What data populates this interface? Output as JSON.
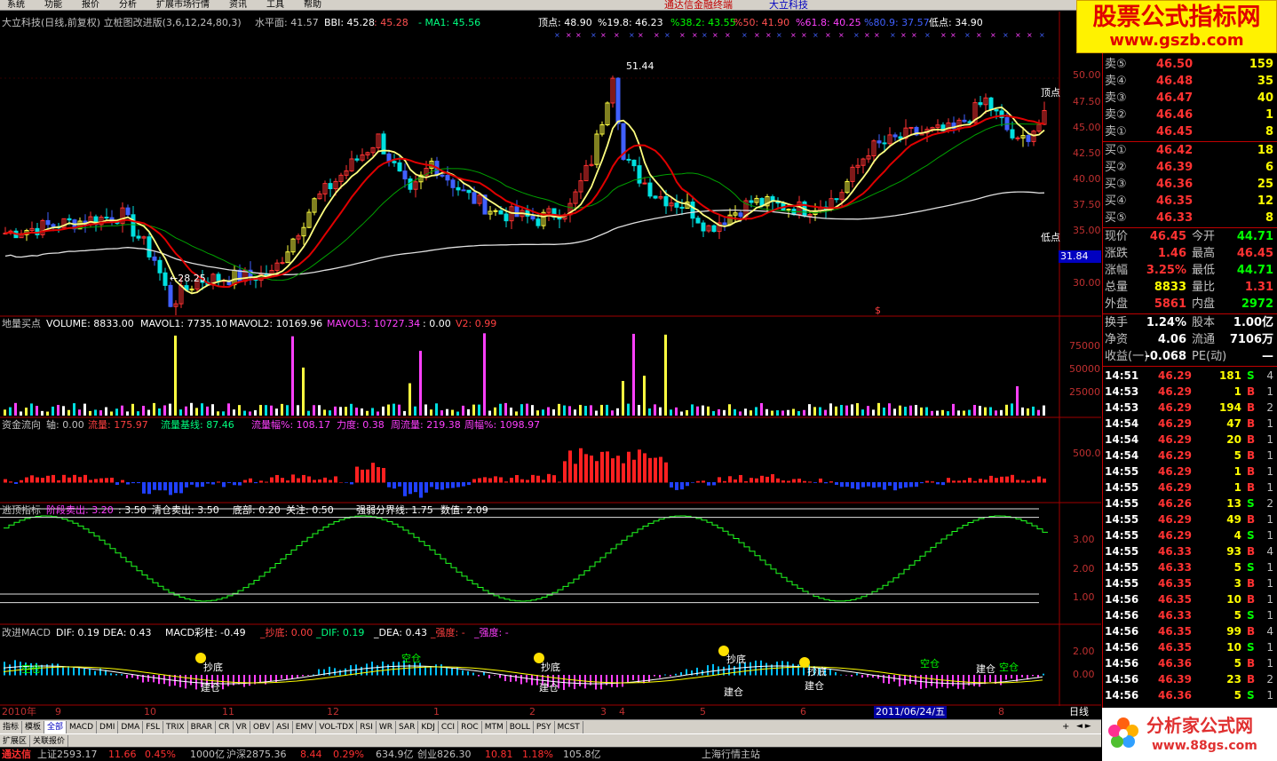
{
  "menu": {
    "items": [
      "系统",
      "功能",
      "报价",
      "分析",
      "扩展市场行情",
      "资讯",
      "工具",
      "帮助"
    ],
    "app_title": "通达信金融终端",
    "stock_title": "大立科技"
  },
  "brand": {
    "title": "股票公式指标网",
    "url": "www.gszb.com"
  },
  "main": {
    "title": "大立科技(日线,前复权) 立桩图改进版(3,6,12,24,80,3)",
    "level": "水平面: 41.57",
    "bbi": "BBI: 45.28",
    "v1": ": 45.28",
    "ma1": "- MA1: 45.56",
    "ding": "顶点: 48.90",
    "p198": "%19.8: 46.23",
    "p382": "%38.2: 43.55",
    "p50": "%50: 41.90",
    "p618": "%61.8: 40.25",
    "p809": "%80.9: 37.57",
    "di": "低点: 34.90",
    "high_label": "51.44",
    "low_label": "←28.25",
    "top_marker": "顶点",
    "bottom_marker": "低点",
    "price_flag": "31.84",
    "s_mark": "$",
    "yticks": [
      "50.00",
      "47.50",
      "45.00",
      "42.50",
      "40.00",
      "37.50",
      "35.00",
      "30.00"
    ]
  },
  "volume": {
    "title": "地量买点",
    "vol": "VOLUME: 8833.00",
    "mavol1": "MAVOL1: 7735.10",
    "mavol2": "MAVOL2: 10169.96",
    "mavol3": "MAVOL3: 10727.34",
    "v1": ": 0.00",
    "v2": "V2: 0.99",
    "yticks": [
      "75000",
      "50000",
      "25000"
    ]
  },
  "fund": {
    "title": "资金流向",
    "axis": "轴: 0.00",
    "flow": "流量: 175.97",
    "base": "流量基线: 87.46",
    "amp": "流量幅%: 108.17",
    "force": "力度: 0.38",
    "week": "周流量: 219.38",
    "weekamp": "周幅%: 1098.97",
    "yticks": [
      "500.0"
    ]
  },
  "escape": {
    "title": "逃顶指标",
    "stage": "阶段卖出: 3.20",
    "v": ": 3.50",
    "clear": "清仓卖出: 3.50",
    "bottom": "底部: 0.20",
    "focus": "关注: 0.50",
    "line": "强弱分界线: 1.75",
    "value": "数值: 2.09",
    "yticks": [
      "3.00",
      "2.00",
      "1.00"
    ]
  },
  "macd": {
    "title": "改进MACD",
    "dif": "DIF: 0.19",
    "dea": "DEA: 0.43",
    "bar": "MACD彩柱: -0.49",
    "chaodi": "_抄底: 0.00",
    "dif2": "_DIF: 0.19",
    "dea2": "_DEA: 0.43",
    "strong": "_强度: -",
    "strong2": "_强度: -",
    "yticks": [
      "2.00",
      "0.00"
    ],
    "marks": [
      "抄底",
      "抄底",
      "抄底",
      "抄底",
      "建仓",
      "建仓",
      "建仓",
      "建仓",
      "建仓",
      "空仓",
      "空仓",
      "空仓",
      "空仓"
    ]
  },
  "xaxis": {
    "labels": [
      "2010年",
      "9",
      "10",
      "11",
      "12",
      "1",
      "2",
      "3",
      "4",
      "5",
      "6",
      "2011/06/24/五",
      "8"
    ],
    "period": "日线"
  },
  "quote": {
    "asks": [
      {
        "label": "卖⑤",
        "price": "46.50",
        "vol": "159"
      },
      {
        "label": "卖④",
        "price": "46.48",
        "vol": "35"
      },
      {
        "label": "卖③",
        "price": "46.47",
        "vol": "40"
      },
      {
        "label": "卖②",
        "price": "46.46",
        "vol": "1"
      },
      {
        "label": "卖①",
        "price": "46.45",
        "vol": "8"
      }
    ],
    "bids": [
      {
        "label": "买①",
        "price": "46.42",
        "vol": "18"
      },
      {
        "label": "买②",
        "price": "46.39",
        "vol": "6"
      },
      {
        "label": "买③",
        "price": "46.36",
        "vol": "25"
      },
      {
        "label": "买④",
        "price": "46.35",
        "vol": "12"
      },
      {
        "label": "买⑤",
        "price": "46.33",
        "vol": "8"
      }
    ],
    "stats": [
      {
        "l1": "现价",
        "v1": "46.45",
        "c1": "#ff3232",
        "l2": "今开",
        "v2": "44.71",
        "c2": "#00ff00"
      },
      {
        "l1": "涨跌",
        "v1": "1.46",
        "c1": "#ff3232",
        "l2": "最高",
        "v2": "46.45",
        "c2": "#ff3232"
      },
      {
        "l1": "涨幅",
        "v1": "3.25%",
        "c1": "#ff3232",
        "l2": "最低",
        "v2": "44.71",
        "c2": "#00ff00"
      },
      {
        "l1": "总量",
        "v1": "8833",
        "c1": "#ffff00",
        "l2": "量比",
        "v2": "1.31",
        "c2": "#ff3232"
      },
      {
        "l1": "外盘",
        "v1": "5861",
        "c1": "#ff3232",
        "l2": "内盘",
        "v2": "2972",
        "c2": "#00ff00"
      }
    ],
    "stats2": [
      {
        "l1": "换手",
        "v1": "1.24%",
        "l2": "股本",
        "v2": "1.00亿"
      },
      {
        "l1": "净资",
        "v1": "4.06",
        "l2": "流通",
        "v2": "7106万"
      },
      {
        "l1": "收益(一)",
        "v1": "-0.068",
        "l2": "PE(动)",
        "v2": "—"
      }
    ]
  },
  "ticks": [
    {
      "t": "14:51",
      "p": "46.29",
      "v": "181",
      "d": "S",
      "n": "4"
    },
    {
      "t": "14:53",
      "p": "46.29",
      "v": "1",
      "d": "B",
      "n": "1"
    },
    {
      "t": "14:53",
      "p": "46.29",
      "v": "194",
      "d": "B",
      "n": "2"
    },
    {
      "t": "14:54",
      "p": "46.29",
      "v": "47",
      "d": "B",
      "n": "1"
    },
    {
      "t": "14:54",
      "p": "46.29",
      "v": "20",
      "d": "B",
      "n": "1"
    },
    {
      "t": "14:54",
      "p": "46.29",
      "v": "5",
      "d": "B",
      "n": "1"
    },
    {
      "t": "14:55",
      "p": "46.29",
      "v": "1",
      "d": "B",
      "n": "1"
    },
    {
      "t": "14:55",
      "p": "46.29",
      "v": "1",
      "d": "B",
      "n": "1"
    },
    {
      "t": "14:55",
      "p": "46.26",
      "v": "13",
      "d": "S",
      "n": "2"
    },
    {
      "t": "14:55",
      "p": "46.29",
      "v": "49",
      "d": "B",
      "n": "1"
    },
    {
      "t": "14:55",
      "p": "46.29",
      "v": "4",
      "d": "S",
      "n": "1"
    },
    {
      "t": "14:55",
      "p": "46.33",
      "v": "93",
      "d": "B",
      "n": "4"
    },
    {
      "t": "14:55",
      "p": "46.33",
      "v": "5",
      "d": "S",
      "n": "1"
    },
    {
      "t": "14:55",
      "p": "46.35",
      "v": "3",
      "d": "B",
      "n": "1"
    },
    {
      "t": "14:56",
      "p": "46.35",
      "v": "10",
      "d": "B",
      "n": "1"
    },
    {
      "t": "14:56",
      "p": "46.33",
      "v": "5",
      "d": "S",
      "n": "1"
    },
    {
      "t": "14:56",
      "p": "46.35",
      "v": "99",
      "d": "B",
      "n": "4"
    },
    {
      "t": "14:56",
      "p": "46.35",
      "v": "10",
      "d": "S",
      "n": "1"
    },
    {
      "t": "14:56",
      "p": "46.36",
      "v": "5",
      "d": "B",
      "n": "1"
    },
    {
      "t": "14:56",
      "p": "46.39",
      "v": "23",
      "d": "B",
      "n": "2"
    },
    {
      "t": "14:56",
      "p": "46.36",
      "v": "5",
      "d": "S",
      "n": "1"
    }
  ],
  "tabs": {
    "items": [
      "指标",
      "模板",
      "全部",
      "MACD",
      "DMI",
      "DMA",
      "FSL",
      "TRIX",
      "BRAR",
      "CR",
      "VR",
      "OBV",
      "ASI",
      "EMV",
      "VOL-TDX",
      "RSI",
      "WR",
      "SAR",
      "KDJ",
      "CCI",
      "ROC",
      "MTM",
      "BOLL",
      "PSY",
      "MCST"
    ],
    "row2": [
      "扩展区",
      "关联报价"
    ],
    "plus": "+",
    "arrows": "◄ ►"
  },
  "status": {
    "brand": "通达信",
    "sh": "上证2593.17",
    "sh_chg": "11.66",
    "sh_pct": "0.45%",
    "sh_amt": "1000亿",
    "sz": "沪深2875.36",
    "sz_chg": "8.44",
    "sz_pct": "0.29%",
    "sz_amt": "634.9亿",
    "cy": "创业826.30",
    "cy_chg": "10.81",
    "cy_pct": "1.18%",
    "cy_amt": "105.8亿",
    "right": "上海行情主站"
  },
  "logo": {
    "text": "分析家公式网",
    "url": "www.88gs.com"
  }
}
